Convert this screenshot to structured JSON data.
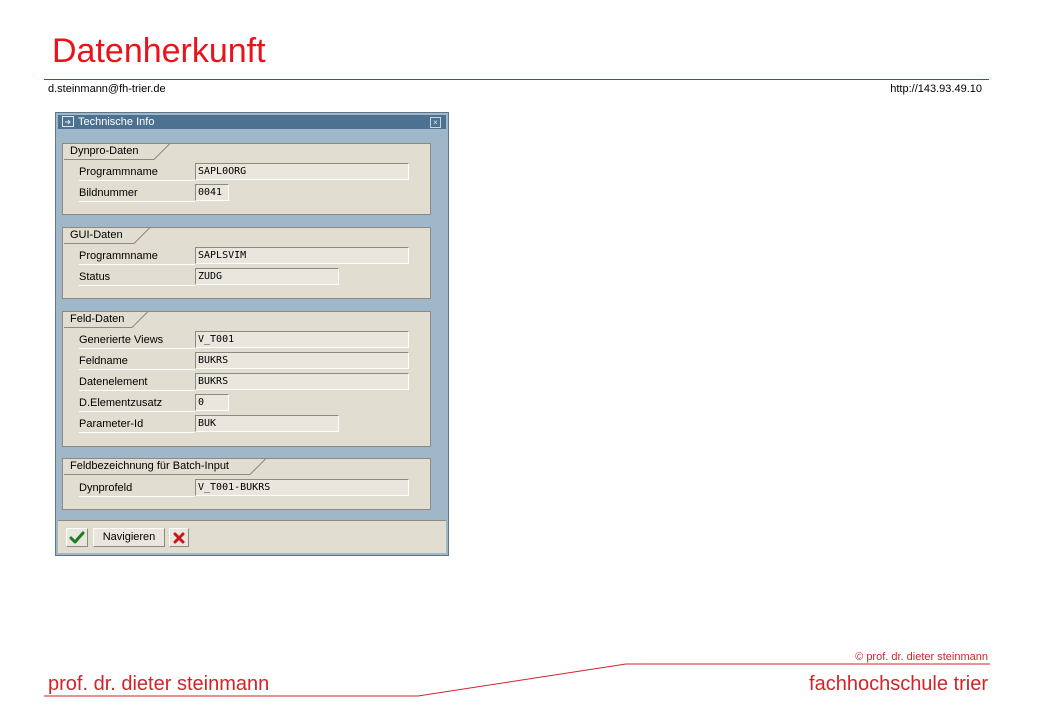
{
  "slide": {
    "title": "Datenherkunft",
    "email": "d.steinmann@fh-trier.de",
    "url": "http://143.93.49.10"
  },
  "dialog": {
    "title": "Technische Info",
    "groups": [
      {
        "title": "Dynpro-Daten",
        "rows": [
          {
            "label": "Programmname",
            "value": "SAPL0ORG"
          },
          {
            "label": "Bildnummer",
            "value": "0041"
          }
        ]
      },
      {
        "title": "GUI-Daten",
        "rows": [
          {
            "label": "Programmname",
            "value": "SAPLSVIM"
          },
          {
            "label": "Status",
            "value": "ZUDG"
          }
        ]
      },
      {
        "title": "Feld-Daten",
        "rows": [
          {
            "label": "Generierte Views",
            "value": "V_T001"
          },
          {
            "label": "Feldname",
            "value": "BUKRS"
          },
          {
            "label": "Datenelement",
            "value": "BUKRS"
          },
          {
            "label": "D.Elementzusatz",
            "value": "0"
          },
          {
            "label": "Parameter-Id",
            "value": "BUK"
          }
        ]
      },
      {
        "title": "Feldbezeichnung für Batch-Input",
        "rows": [
          {
            "label": "Dynprofeld",
            "value": "V_T001-BUKRS"
          }
        ]
      }
    ],
    "toolbar": {
      "confirm_icon": "checkmark-icon",
      "navigate_label": "Navigieren",
      "cancel_icon": "cancel-x-icon"
    }
  },
  "footer": {
    "copyright": "© prof. dr. dieter steinmann",
    "author": "prof. dr. dieter steinmann",
    "school": "fachhochschule trier"
  },
  "colors": {
    "accent_red": "#e8141c",
    "dialog_frame": "#9fb7c9",
    "titlebar": "#4d7190",
    "panel": "#e1ddd1"
  }
}
